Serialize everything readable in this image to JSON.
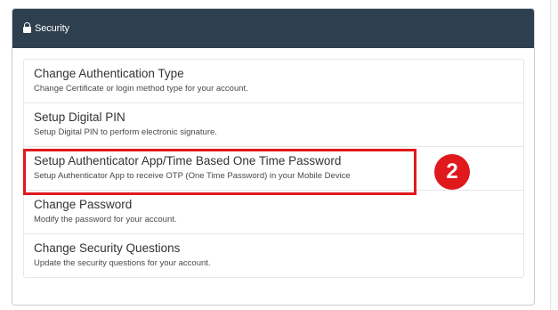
{
  "panel": {
    "title": "Security",
    "icon": "lock-icon",
    "header_color": "#2e3f4f"
  },
  "items": [
    {
      "title": "Change Authentication Type",
      "description": "Change Certificate or login method type for your account."
    },
    {
      "title": "Setup Digital PIN",
      "description": "Setup Digital PIN to perform electronic signature."
    },
    {
      "title": "Setup Authenticator App/Time Based One Time Password",
      "description": "Setup Authenticator App to receive OTP (One Time Password) in your Mobile Device"
    },
    {
      "title": "Change Password",
      "description": "Modify the password for your account."
    },
    {
      "title": "Change Security Questions",
      "description": "Update the security questions for your account."
    }
  ],
  "annotation": {
    "step_number": "2",
    "highlight_color": "#e0191d"
  }
}
